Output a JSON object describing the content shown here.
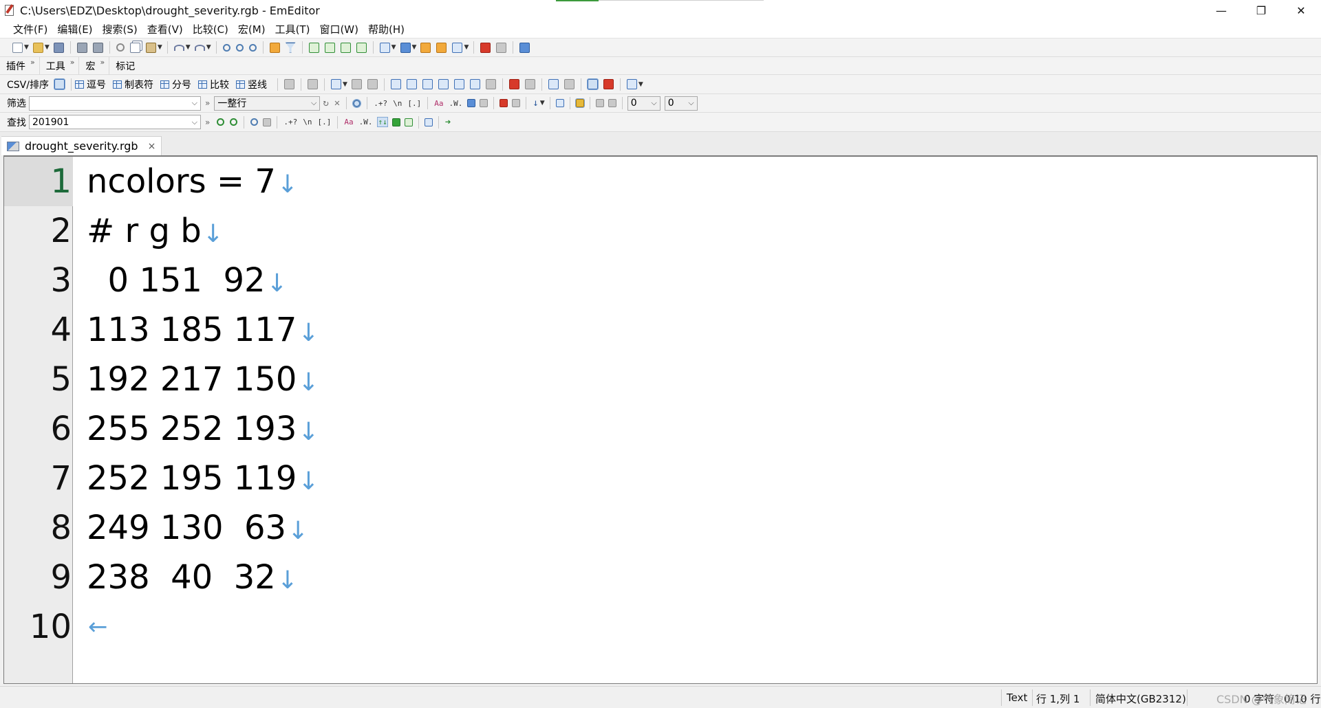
{
  "window": {
    "title": "C:\\Users\\EDZ\\Desktop\\drought_severity.rgb - EmEditor",
    "minimize": "—",
    "restore": "❐",
    "close": "✕"
  },
  "menu": [
    "文件(F)",
    "编辑(E)",
    "搜索(S)",
    "查看(V)",
    "比较(C)",
    "宏(M)",
    "工具(T)",
    "窗口(W)",
    "帮助(H)"
  ],
  "toolbar_tabs": [
    "插件",
    "工具",
    "宏",
    "标记"
  ],
  "csv_toolbar": {
    "label": "CSV/排序",
    "buttons": [
      "逗号",
      "制表符",
      "分号",
      "比较",
      "竖线"
    ]
  },
  "filter_bar": {
    "label": "筛选",
    "value": "",
    "mode": "一整行",
    "spin1": "0",
    "spin2": "0"
  },
  "find_bar": {
    "label": "查找",
    "value": "201901"
  },
  "tab": {
    "filename": "drought_severity.rgb",
    "close": "×"
  },
  "editor": {
    "lines": [
      {
        "num": "1",
        "text": "ncolors = 7"
      },
      {
        "num": "2",
        "text": "# r g b"
      },
      {
        "num": "3",
        "text": "  0 151  92"
      },
      {
        "num": "4",
        "text": "113 185 117"
      },
      {
        "num": "5",
        "text": "192 217 150"
      },
      {
        "num": "6",
        "text": "255 252 193"
      },
      {
        "num": "7",
        "text": "252 195 119"
      },
      {
        "num": "8",
        "text": "249 130  63"
      },
      {
        "num": "9",
        "text": "238  40  32"
      },
      {
        "num": "10",
        "text": ""
      }
    ],
    "eol_mark": "↓",
    "eof_mark": "←"
  },
  "status": {
    "mode": "Text",
    "position": "行 1,列 1",
    "encoding": "简体中文(GB2312)",
    "selection": "0 字符",
    "lines": "0/10 行",
    "watermark": "CSDN @气象简记"
  }
}
